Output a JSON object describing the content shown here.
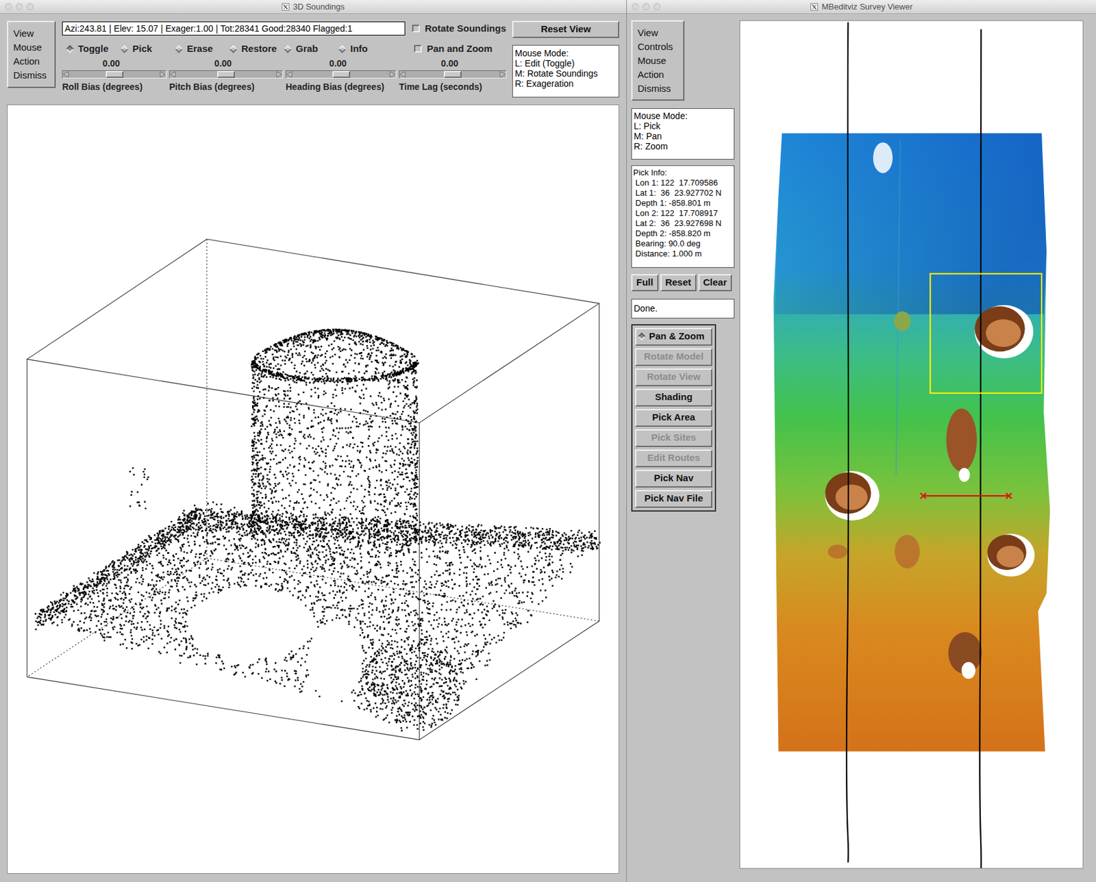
{
  "soundings": {
    "title": "3D Soundings",
    "menu": [
      "View",
      "Mouse",
      "Action",
      "Dismiss"
    ],
    "status": "Azi:243.81 | Elev: 15.07 | Exager:1.00 | Tot:28341 Good:28340 Flagged:1",
    "modes": [
      {
        "label": "Toggle",
        "selected": true
      },
      {
        "label": "Pick",
        "selected": false
      },
      {
        "label": "Erase",
        "selected": false
      },
      {
        "label": "Restore",
        "selected": false
      },
      {
        "label": "Grab",
        "selected": false
      },
      {
        "label": "Info",
        "selected": false
      }
    ],
    "checkboxes": [
      {
        "label": "Rotate Soundings",
        "checked": false
      },
      {
        "label": "Pan and Zoom",
        "checked": false
      }
    ],
    "sliders": [
      {
        "label": "Roll Bias (degrees)",
        "value": "0.00",
        "level": 0.5
      },
      {
        "label": "Pitch Bias (degrees)",
        "value": "0.00",
        "level": 0.5
      },
      {
        "label": "Heading Bias (degrees)",
        "value": "0.00",
        "level": 0.5
      },
      {
        "label": "Time Lag (seconds)",
        "value": "0.00",
        "level": 0.5
      }
    ],
    "reset_button": "Reset View",
    "mouse_mode": [
      "Mouse Mode:",
      "L: Edit (Toggle)",
      "M: Rotate Soundings",
      "R: Exageration"
    ]
  },
  "survey": {
    "title": "MBeditviz Survey Viewer",
    "menu": [
      "View",
      "Controls",
      "Mouse",
      "Action",
      "Dismiss"
    ],
    "mouse_mode": [
      "Mouse Mode:",
      "L: Pick",
      "M: Pan",
      "R: Zoom"
    ],
    "pick_info": [
      "Pick Info:",
      " Lon 1: 122  17.709586",
      " Lat 1:  36  23.927702 N",
      " Depth 1: -858.801 m",
      " Lon 2: 122  17.708917",
      " Lat 2:  36  23.927698 N",
      " Depth 2: -858.820 m",
      " Bearing: 90.0 deg",
      " Distance: 1.000 m"
    ],
    "view_buttons": [
      "Full",
      "Reset",
      "Clear"
    ],
    "status": "Done.",
    "tools": [
      {
        "label": "Pan & Zoom",
        "kind": "radio",
        "selected": true,
        "disabled": false
      },
      {
        "label": "Rotate Model",
        "kind": "button",
        "selected": false,
        "disabled": true
      },
      {
        "label": "Rotate View",
        "kind": "button",
        "selected": false,
        "disabled": true
      },
      {
        "label": "Shading",
        "kind": "button",
        "selected": false,
        "disabled": false
      },
      {
        "label": "Pick Area",
        "kind": "button",
        "selected": false,
        "disabled": false
      },
      {
        "label": "Pick Sites",
        "kind": "button",
        "selected": false,
        "disabled": true
      },
      {
        "label": "Edit Routes",
        "kind": "button",
        "selected": false,
        "disabled": true
      },
      {
        "label": "Pick Nav",
        "kind": "button",
        "selected": false,
        "disabled": false
      },
      {
        "label": "Pick Nav File",
        "kind": "button",
        "selected": false,
        "disabled": false
      }
    ]
  }
}
